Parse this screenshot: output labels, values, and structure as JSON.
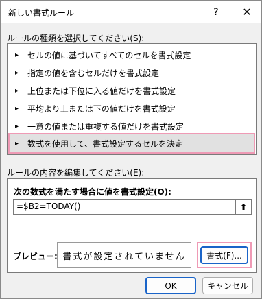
{
  "window": {
    "title": "新しい書式ルール",
    "help_label": "?",
    "close_label": "✕"
  },
  "rule_type": {
    "label": "ルールの種類を選択してください(S):",
    "items": [
      {
        "label": "セルの値に基づいてすべてのセルを書式設定",
        "selected": false
      },
      {
        "label": "指定の値を含むセルだけを書式設定",
        "selected": false
      },
      {
        "label": "上位または下位に入る値だけを書式設定",
        "selected": false
      },
      {
        "label": "平均より上または下の値だけを書式設定",
        "selected": false
      },
      {
        "label": "一意の値または重複する値だけを書式設定",
        "selected": false
      },
      {
        "label": "数式を使用して、書式設定するセルを決定",
        "selected": true
      }
    ],
    "item_icon": "▸"
  },
  "rule_edit": {
    "label": "ルールの内容を編集してください(E):",
    "formula_label": "次の数式を満たす場合に値を書式設定(O):",
    "formula_value": "=$B2=TODAY()",
    "collapse_icon": "⬆",
    "preview_label": "プレビュー:",
    "preview_text": "書式が設定されていません",
    "format_button": "書式(F)..."
  },
  "footer": {
    "ok_label": "OK",
    "cancel_label": "キャンセル"
  },
  "colors": {
    "highlight": "#ef9ab5",
    "focus": "#1a64c8"
  }
}
